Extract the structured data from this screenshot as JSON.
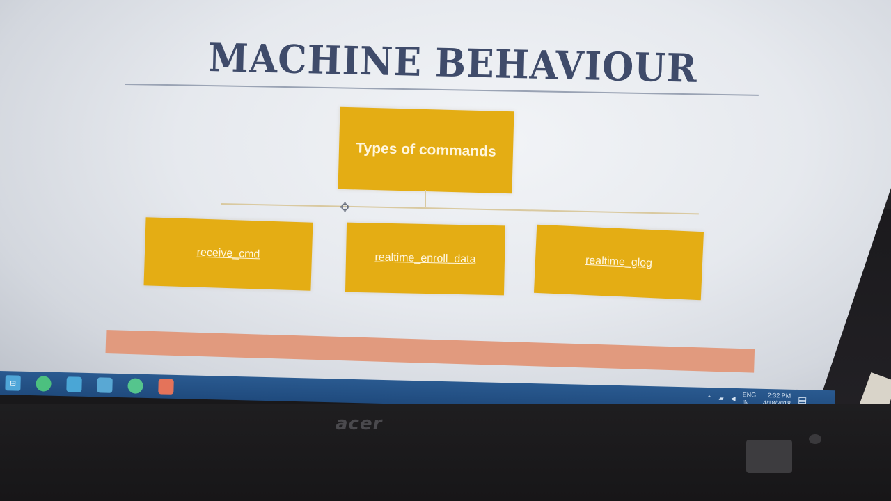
{
  "slide": {
    "title": "MACHINE BEHAVIOUR",
    "root_box": "Types of commands",
    "child_boxes": [
      "receive_cmd",
      "realtime_enroll_data",
      "realtime_glog"
    ]
  },
  "taskbar": {
    "icons": [
      "windows-start-icon",
      "chrome-icon",
      "store-icon",
      "file-explorer-icon",
      "whatsapp-icon",
      "powerpoint-icon"
    ],
    "tray": {
      "lang_top": "ENG",
      "lang_bottom": "IN",
      "time": "2:32 PM",
      "date": "4/18/2018"
    }
  },
  "bezel": {
    "brand": "acer"
  },
  "colors": {
    "box_fill": "#e4ad14",
    "title_color": "#3f4b6a",
    "bar_fill": "#e19a7e",
    "taskbar": "#1f4a7d"
  }
}
